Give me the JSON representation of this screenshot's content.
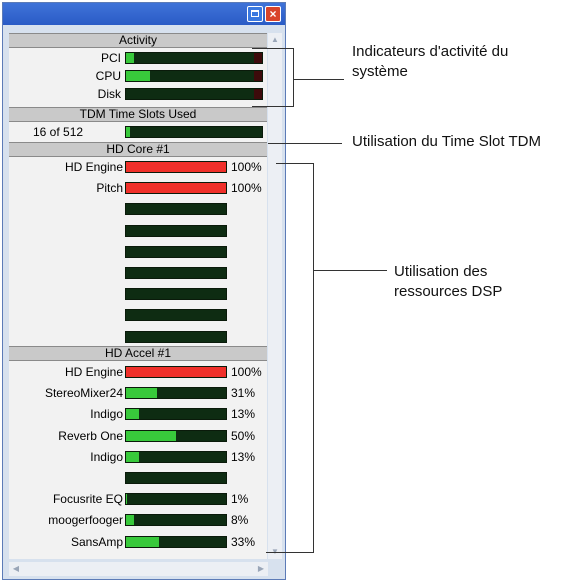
{
  "window": {
    "activity": {
      "header": "Activity",
      "meters": [
        {
          "label": "PCI",
          "level": 0.06
        },
        {
          "label": "CPU",
          "level": 0.18
        },
        {
          "label": "Disk",
          "level": 0.0
        }
      ]
    },
    "tdm": {
      "header": "TDM Time Slots Used",
      "value_text": "16 of 512",
      "level": 0.03
    },
    "hd_core": {
      "header": "HD Core #1",
      "meters": [
        {
          "label": "HD Engine",
          "percent": "100%",
          "level": 1.0,
          "color": "#f0302a"
        },
        {
          "label": "Pitch",
          "percent": "100%",
          "level": 1.0,
          "color": "#f0302a"
        },
        {
          "label": "",
          "percent": "",
          "level": 0
        },
        {
          "label": "",
          "percent": "",
          "level": 0
        },
        {
          "label": "",
          "percent": "",
          "level": 0
        },
        {
          "label": "",
          "percent": "",
          "level": 0
        },
        {
          "label": "",
          "percent": "",
          "level": 0
        },
        {
          "label": "",
          "percent": "",
          "level": 0
        },
        {
          "label": "",
          "percent": "",
          "level": 0
        }
      ]
    },
    "hd_accel": {
      "header": "HD Accel #1",
      "meters": [
        {
          "label": "HD Engine",
          "percent": "100%",
          "level": 1.0,
          "color": "#f0302a"
        },
        {
          "label": "StereoMixer24",
          "percent": "31%",
          "level": 0.31,
          "color": "#38c93b"
        },
        {
          "label": "Indigo",
          "percent": "13%",
          "level": 0.13,
          "color": "#38c93b"
        },
        {
          "label": "Reverb One",
          "percent": "50%",
          "level": 0.5,
          "color": "#38c93b"
        },
        {
          "label": "Indigo",
          "percent": "13%",
          "level": 0.13,
          "color": "#38c93b"
        },
        {
          "label": "",
          "percent": "",
          "level": 0
        },
        {
          "label": "Focusrite EQ",
          "percent": "1%",
          "level": 0.01,
          "color": "#38c93b"
        },
        {
          "label": "moogerfooger",
          "percent": "8%",
          "level": 0.08,
          "color": "#38c93b"
        },
        {
          "label": "SansAmp",
          "percent": "33%",
          "level": 0.33,
          "color": "#38c93b"
        }
      ]
    }
  },
  "annotations": {
    "activity": "Indicateurs d'activité du système",
    "tdm": "Utilisation du Time Slot TDM",
    "dsp": "Utilisation des ressources DSP"
  }
}
